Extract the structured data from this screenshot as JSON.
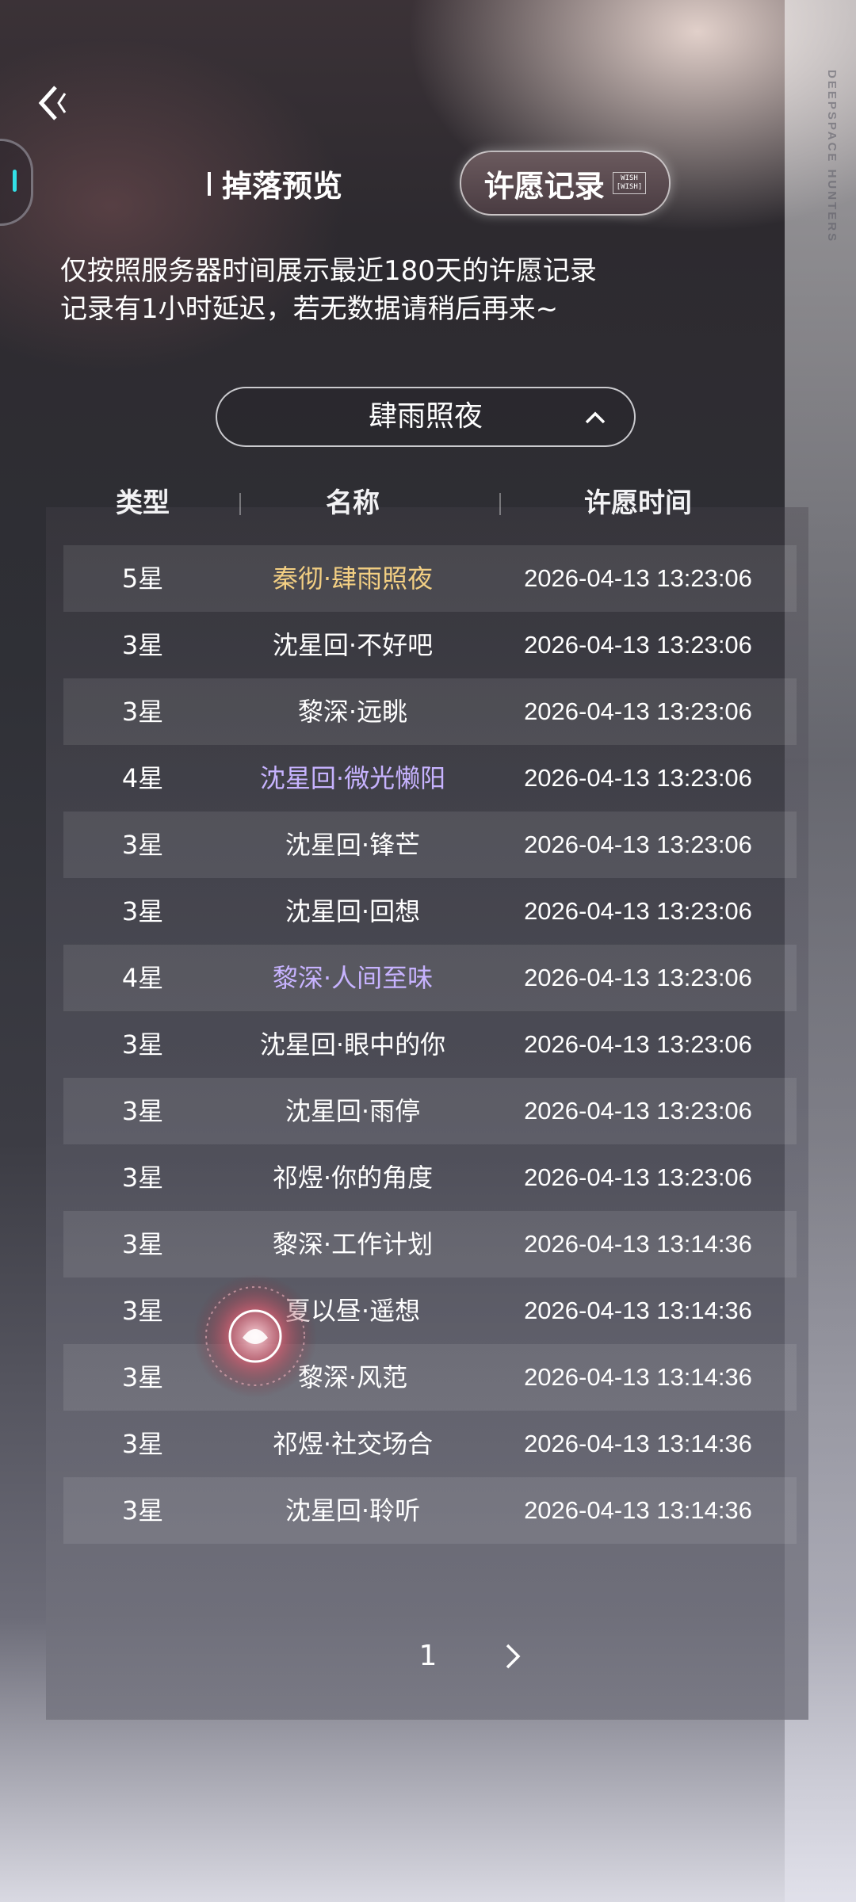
{
  "header": {
    "back_icon": "back-arrow-icon",
    "watermark": "DEEPSPACE HUNTERS",
    "tabs": [
      {
        "label": "掉落预览",
        "active": false
      },
      {
        "label": "许愿记录",
        "active": true,
        "tag_line1": "WISH",
        "tag_line2": "[WISH]"
      }
    ]
  },
  "notice": {
    "line1": "仅按照服务器时间展示最近180天的许愿记录",
    "line2": "记录有1小时延迟，若无数据请稍后再来~"
  },
  "filter": {
    "selected": "肆雨照夜",
    "chevron_icon": "chevron-up-icon"
  },
  "table": {
    "columns": [
      "类型",
      "名称",
      "许愿时间"
    ],
    "colors": {
      "5星": "#f3cf83",
      "4星": "#c7b3ff",
      "3星": "#ffffff"
    },
    "rows": [
      {
        "type": "5星",
        "name": "秦彻·肆雨照夜",
        "time": "2026-04-13 13:23:06"
      },
      {
        "type": "3星",
        "name": "沈星回·不好吧",
        "time": "2026-04-13 13:23:06"
      },
      {
        "type": "3星",
        "name": "黎深·远眺",
        "time": "2026-04-13 13:23:06"
      },
      {
        "type": "4星",
        "name": "沈星回·微光懒阳",
        "time": "2026-04-13 13:23:06"
      },
      {
        "type": "3星",
        "name": "沈星回·锋芒",
        "time": "2026-04-13 13:23:06"
      },
      {
        "type": "3星",
        "name": "沈星回·回想",
        "time": "2026-04-13 13:23:06"
      },
      {
        "type": "4星",
        "name": "黎深·人间至味",
        "time": "2026-04-13 13:23:06"
      },
      {
        "type": "3星",
        "name": "沈星回·眼中的你",
        "time": "2026-04-13 13:23:06"
      },
      {
        "type": "3星",
        "name": "沈星回·雨停",
        "time": "2026-04-13 13:23:06"
      },
      {
        "type": "3星",
        "name": "祁煜·你的角度",
        "time": "2026-04-13 13:23:06"
      },
      {
        "type": "3星",
        "name": "黎深·工作计划",
        "time": "2026-04-13 13:14:36"
      },
      {
        "type": "3星",
        "name": "夏以昼·遥想",
        "time": "2026-04-13 13:14:36"
      },
      {
        "type": "3星",
        "name": "黎深·风范",
        "time": "2026-04-13 13:14:36"
      },
      {
        "type": "3星",
        "name": "祁煜·社交场合",
        "time": "2026-04-13 13:14:36"
      },
      {
        "type": "3星",
        "name": "沈星回·聆听",
        "time": "2026-04-13 13:14:36"
      }
    ]
  },
  "pagination": {
    "current_page": "1",
    "next_icon": "chevron-right-icon"
  }
}
